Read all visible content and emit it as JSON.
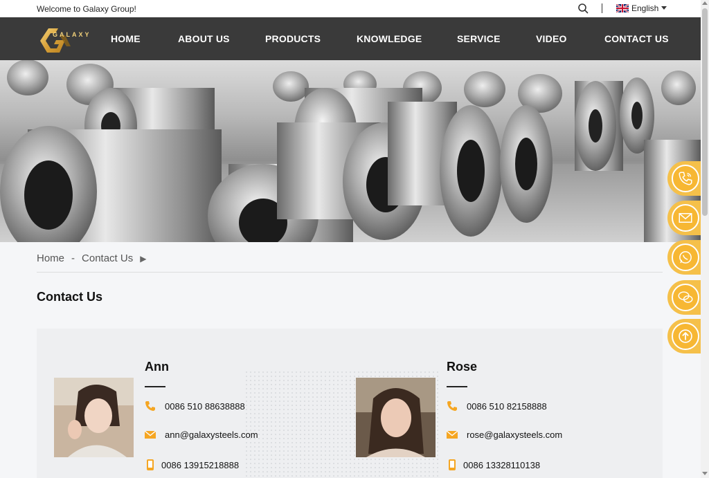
{
  "topbar": {
    "welcome": "Welcome to Galaxy Group!",
    "language": "English",
    "search_icon": "search-icon",
    "flag_icon": "uk-flag-icon"
  },
  "nav": {
    "logo_text": "GALAXY",
    "items": [
      "HOME",
      "ABOUT US",
      "PRODUCTS",
      "KNOWLEDGE",
      "SERVICE",
      "VIDEO",
      "CONTACT US"
    ]
  },
  "breadcrumb": {
    "home": "Home",
    "separator": "-",
    "current": "Contact Us"
  },
  "page_title": "Contact Us",
  "contacts": [
    {
      "name": "Ann",
      "phone": "0086 510 88638888",
      "email": "ann@galaxysteels.com",
      "mobile": "0086 13915218888"
    },
    {
      "name": "Rose",
      "phone": "0086 510 82158888",
      "email": "rose@galaxysteels.com",
      "mobile": "0086 13328110138"
    }
  ],
  "float_buttons": [
    "phone-icon",
    "mail-icon",
    "whatsapp-icon",
    "wechat-icon",
    "back-to-top-icon"
  ],
  "colors": {
    "accent": "#f7b733",
    "nav_bg": "#3a3a3a",
    "icon_orange": "#f5a623"
  }
}
